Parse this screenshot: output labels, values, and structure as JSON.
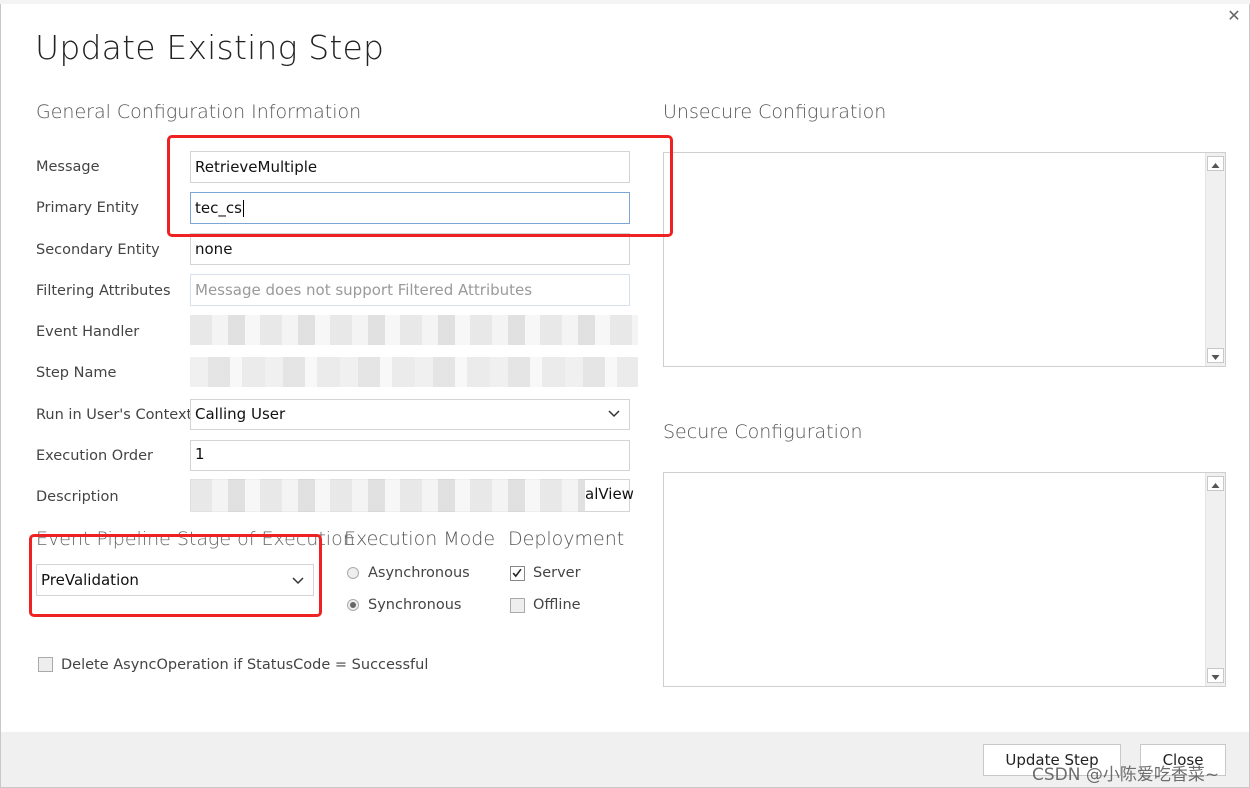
{
  "dialog": {
    "title": "Update Existing Step",
    "close_icon": "close-icon"
  },
  "general": {
    "heading": "General Configuration Information",
    "message_label": "Message",
    "message_value": "RetrieveMultiple",
    "primary_entity_label": "Primary Entity",
    "primary_entity_value": "tec_cs",
    "secondary_entity_label": "Secondary Entity",
    "secondary_entity_value": "none",
    "filtering_label": "Filtering Attributes",
    "filtering_placeholder": "Message does not support Filtered Attributes",
    "event_handler_label": "Event Handler",
    "step_name_label": "Step Name",
    "run_context_label": "Run in User's Context",
    "run_context_value": "Calling User",
    "execution_order_label": "Execution Order",
    "execution_order_value": "1",
    "description_label": "Description",
    "description_visible_tail": "alView"
  },
  "stage": {
    "heading": "Event Pipeline Stage of Execution",
    "value": "PreValidation"
  },
  "mode": {
    "heading": "Execution Mode",
    "options": [
      "Asynchronous",
      "Synchronous"
    ],
    "selected": "Synchronous"
  },
  "deployment": {
    "heading": "Deployment",
    "server_label": "Server",
    "server_checked": true,
    "offline_label": "Offline",
    "offline_checked": false
  },
  "delete_async": {
    "label": "Delete AsyncOperation if StatusCode = Successful",
    "checked": false
  },
  "unsecure": {
    "heading": "Unsecure  Configuration"
  },
  "secure": {
    "heading": "Secure  Configuration"
  },
  "footer": {
    "update_button": "Update Step",
    "close_button": "Close"
  },
  "watermark": "CSDN @小陈爱吃香菜~",
  "colors": {
    "highlight_box": "#ee2222",
    "footer_bg": "#f0f0f0",
    "focus_border": "#7da5d6"
  }
}
